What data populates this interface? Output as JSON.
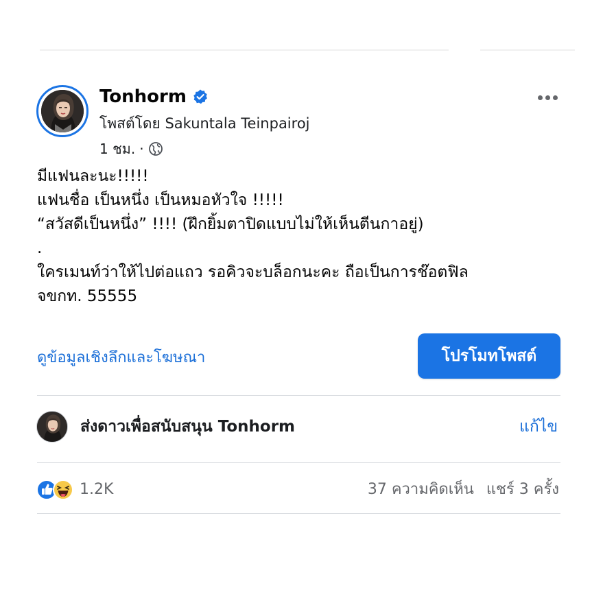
{
  "post": {
    "page_name": "Tonhorm",
    "posted_by": "โพสต์โดย Sakuntala Teinpairoj",
    "time": "1 ชม.",
    "separator": "·",
    "body_lines": [
      "มีแฟนละนะ!!!!!",
      "แฟนชื่อ เป็นหนึ่ง เป็นหมอหัวใจ !!!!!",
      "“สวัสดีเป็นหนึ่ง” !!!! (ฝึกยิ้มตาปิดแบบไม่ให้เห็นตีนกาอยู่)",
      ".",
      "ใครเมนท์ว่าให้ไปต่อแถว รอคิวจะบล็อกนะคะ ถือเป็นการช๊อตฟิล",
      "จขกท. 55555"
    ]
  },
  "actions": {
    "insights_label": "ดูข้อมูลเชิงลึกและโฆษณา",
    "promote_label": "โปรโมทโพสต์"
  },
  "stars": {
    "label": "ส่งดาวเพื่อสนับสนุน Tonhorm",
    "edit_label": "แก้ไข"
  },
  "engagement": {
    "reaction_count": "1.2K",
    "comments": "37 ความคิดเห็น",
    "shares": "แชร์ 3 ครั้ง"
  },
  "icons": {
    "verified": "verified-badge-icon",
    "audience": "globe-icon",
    "more": "more-options-icon",
    "like": "like-reaction-icon",
    "haha": "haha-reaction-icon"
  },
  "colors": {
    "accent": "#1b74e4",
    "link": "#1b6fd8",
    "secondary_text": "#65676b",
    "divider": "#dadde1"
  }
}
